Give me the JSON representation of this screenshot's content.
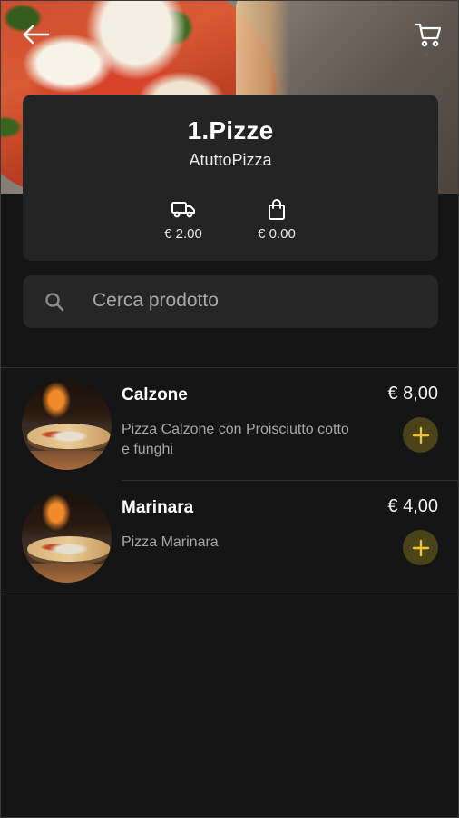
{
  "header": {
    "back_icon": "arrow-left-icon",
    "cart_icon": "shopping-cart-icon"
  },
  "store": {
    "title": "1.Pizze",
    "subtitle": "AtuttoPizza",
    "delivery_icon": "delivery-truck-icon",
    "delivery_fee": "€ 2.00",
    "min_order_icon": "shopping-bag-icon",
    "min_order": "€ 0.00"
  },
  "search": {
    "icon": "search-icon",
    "placeholder": "Cerca prodotto"
  },
  "products": [
    {
      "name": "Calzone",
      "price": "€ 8,00",
      "description": "Pizza Calzone con Proisciutto cotto e funghi"
    },
    {
      "name": "Marinara",
      "price": "€ 4,00",
      "description": "Pizza Marinara"
    }
  ],
  "colors": {
    "background": "#151515",
    "card": "#242424",
    "accent": "#f2c12e",
    "add_button_bg": "#4a4218"
  }
}
